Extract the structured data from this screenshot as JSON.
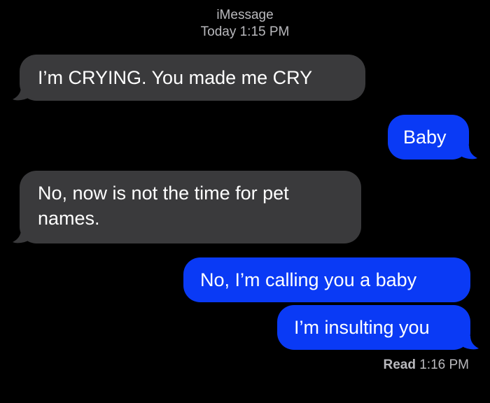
{
  "header": {
    "service": "iMessage",
    "timestamp": "Today 1:15 PM"
  },
  "messages": [
    {
      "direction": "received",
      "text": "I’m CRYING. You made me CRY"
    },
    {
      "direction": "sent",
      "text": "Baby"
    },
    {
      "direction": "received",
      "text": "No, now is not the time for pet names."
    },
    {
      "direction": "sent",
      "text": "No, I’m calling you a baby"
    },
    {
      "direction": "sent",
      "text": "I’m insulting you"
    }
  ],
  "read_receipt": {
    "label": "Read",
    "time": "1:16 PM"
  },
  "colors": {
    "background": "#000000",
    "sent_bubble": "#0a3af5",
    "received_bubble": "#3a3a3c",
    "meta_text": "#b9b9bd"
  }
}
